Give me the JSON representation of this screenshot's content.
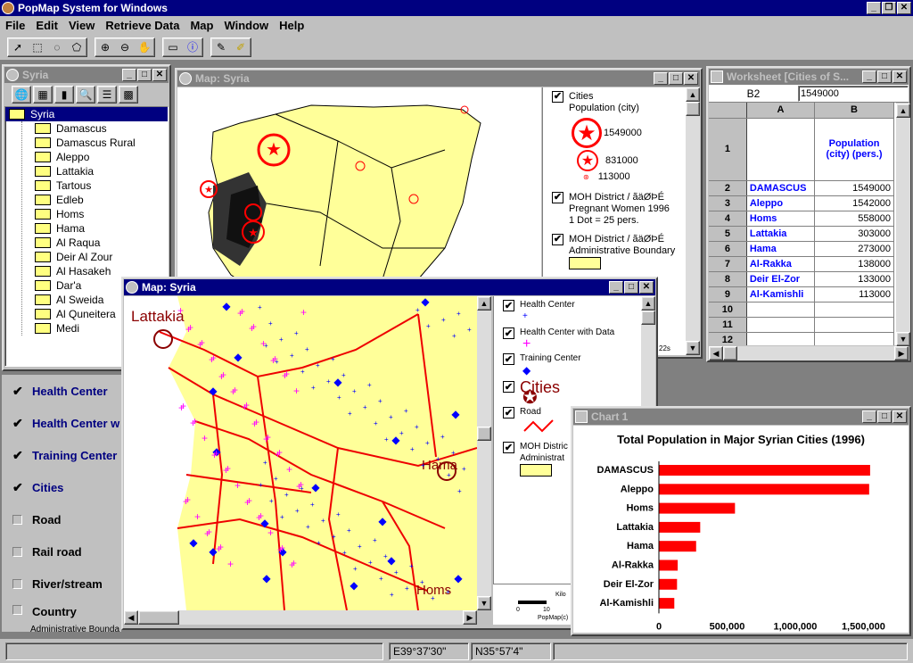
{
  "app": {
    "title": "PopMap System for Windows"
  },
  "menu": [
    "File",
    "Edit",
    "View",
    "Retrieve Data",
    "Map",
    "Window",
    "Help"
  ],
  "tree_window": {
    "title": "Syria",
    "root": "Syria",
    "items": [
      "Damascus",
      "Damascus Rural",
      "Aleppo",
      "Lattakia",
      "Tartous",
      "Edleb",
      "Homs",
      "Hama",
      "Al Raqua",
      "Deir Al Zour",
      "Al Hasakeh",
      "Dar'a",
      "Al Sweida",
      "Al Quneitera",
      "Medi"
    ]
  },
  "layers": [
    {
      "label": "Health Center",
      "checked": true
    },
    {
      "label": "Health Center w",
      "checked": true
    },
    {
      "label": "Training Center",
      "checked": true
    },
    {
      "label": "Cities",
      "checked": true
    },
    {
      "label": "Road",
      "checked": false
    },
    {
      "label": "Rail road",
      "checked": false
    },
    {
      "label": "River/stream",
      "checked": false
    },
    {
      "label": "Country",
      "checked": false,
      "sub": "Administrative Bounda"
    }
  ],
  "map1": {
    "title": "Map: Syria",
    "legend": {
      "cities": "Cities",
      "pop_label": "Population (city)",
      "v1": "1549000",
      "v2": "831000",
      "v3": "113000",
      "moh1": "MOH District / ãäØÞÉ",
      "moh1_sub1": "Pregnant Women 1996",
      "moh1_sub2": "1 Dot = 25 pers.",
      "moh2": "MOH District / ãäØÞÉ",
      "moh2_sub": "Administrative Boundary"
    },
    "scale_text": "22s"
  },
  "map2": {
    "title": "Map: Syria",
    "city1": "Lattakia",
    "city2": "Hama",
    "city3": "Homs",
    "legend": {
      "hc": "Health Center",
      "hcd": "Health Center with Data",
      "tc": "Training Center",
      "cities": "Cities",
      "road": "Road",
      "moh": "MOH Distric",
      "moh_sub": "Administrat"
    },
    "scale_label": "Kilo",
    "scale_nums": [
      "0",
      "10"
    ],
    "scale_foot": "PopMap(c)"
  },
  "worksheet": {
    "title": "Worksheet [Cities of S...",
    "cell_ref": "B2",
    "cell_value": "1549000",
    "col_a": "A",
    "col_b": "B",
    "header_b": "Population (city) (pers.)",
    "rows": [
      {
        "n": "2",
        "a": "DAMASCUS",
        "b": "1549000"
      },
      {
        "n": "3",
        "a": "Aleppo",
        "b": "1542000"
      },
      {
        "n": "4",
        "a": "Homs",
        "b": "558000"
      },
      {
        "n": "5",
        "a": "Lattakia",
        "b": "303000"
      },
      {
        "n": "6",
        "a": "Hama",
        "b": "273000"
      },
      {
        "n": "7",
        "a": "Al-Rakka",
        "b": "138000"
      },
      {
        "n": "8",
        "a": "Deir El-Zor",
        "b": "133000"
      },
      {
        "n": "9",
        "a": "Al-Kamishli",
        "b": "113000"
      },
      {
        "n": "10",
        "a": "",
        "b": ""
      },
      {
        "n": "11",
        "a": "",
        "b": ""
      },
      {
        "n": "12",
        "a": "",
        "b": ""
      }
    ]
  },
  "chart_window": {
    "title": "Chart 1"
  },
  "chart_data": {
    "type": "bar",
    "orientation": "horizontal",
    "title": "Total Population in Major Syrian Cities (1996)",
    "categories": [
      "DAMASCUS",
      "Aleppo",
      "Homs",
      "Lattakia",
      "Hama",
      "Al-Rakka",
      "Deir El-Zor",
      "Al-Kamishli"
    ],
    "values": [
      1549000,
      1542000,
      558000,
      303000,
      273000,
      138000,
      133000,
      113000
    ],
    "xlim": [
      0,
      1700000
    ],
    "xticks": [
      0,
      500000,
      1000000,
      1500000
    ],
    "xtick_labels": [
      "0",
      "500,000",
      "1,000,000",
      "1,500,000"
    ],
    "bar_color": "#ff0000",
    "legend": "none",
    "grid": false
  },
  "status": {
    "coord1": "E39°37'30\"",
    "coord2": "N35°57'4\""
  }
}
